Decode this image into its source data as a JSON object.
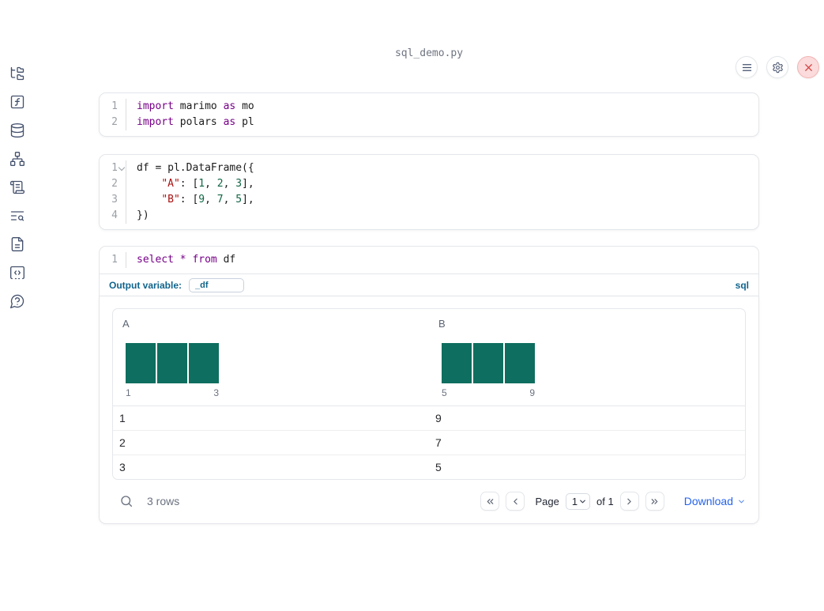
{
  "window": {
    "title": "sql_demo.py"
  },
  "colors": {
    "keyword": "#770088",
    "string": "#aa1111",
    "number": "#116644",
    "histogram_bar": "#0e6e5f",
    "sql_accent": "#10648c",
    "link_blue": "#2563eb",
    "close_red": "#d64545",
    "icon_slate": "#44516d"
  },
  "sidebar": {
    "items": [
      {
        "icon": "file-explorer-icon"
      },
      {
        "icon": "variables-icon"
      },
      {
        "icon": "data-sources-icon"
      },
      {
        "icon": "dependency-graph-icon"
      },
      {
        "icon": "logs-icon"
      },
      {
        "icon": "scratchpad-search-icon"
      },
      {
        "icon": "documentation-icon"
      },
      {
        "icon": "snippets-icon"
      },
      {
        "icon": "help-chat-icon"
      }
    ]
  },
  "toolbar": {
    "buttons": [
      {
        "icon": "menu-icon"
      },
      {
        "icon": "settings-icon"
      },
      {
        "icon": "close-icon"
      }
    ]
  },
  "cells": [
    {
      "name": "imports-cell",
      "lines": [
        {
          "num": "1",
          "tokens": [
            {
              "t": "keyword",
              "s": "import"
            },
            {
              "t": "plain",
              "s": " marimo "
            },
            {
              "t": "keyword",
              "s": "as"
            },
            {
              "t": "plain",
              "s": " mo"
            }
          ]
        },
        {
          "num": "2",
          "tokens": [
            {
              "t": "keyword",
              "s": "import"
            },
            {
              "t": "plain",
              "s": " polars "
            },
            {
              "t": "keyword",
              "s": "as"
            },
            {
              "t": "plain",
              "s": " pl"
            }
          ]
        }
      ]
    },
    {
      "name": "dataframe-cell",
      "lines": [
        {
          "num": "1",
          "fold": true,
          "tokens": [
            {
              "t": "plain",
              "s": "df = pl.DataFrame({"
            }
          ]
        },
        {
          "num": "2",
          "tokens": [
            {
              "t": "plain",
              "s": "    "
            },
            {
              "t": "string",
              "s": "\"A\""
            },
            {
              "t": "plain",
              "s": ": ["
            },
            {
              "t": "number",
              "s": "1"
            },
            {
              "t": "plain",
              "s": ", "
            },
            {
              "t": "number",
              "s": "2"
            },
            {
              "t": "plain",
              "s": ", "
            },
            {
              "t": "number",
              "s": "3"
            },
            {
              "t": "plain",
              "s": "],"
            }
          ]
        },
        {
          "num": "3",
          "tokens": [
            {
              "t": "plain",
              "s": "    "
            },
            {
              "t": "string",
              "s": "\"B\""
            },
            {
              "t": "plain",
              "s": ": ["
            },
            {
              "t": "number",
              "s": "9"
            },
            {
              "t": "plain",
              "s": ", "
            },
            {
              "t": "number",
              "s": "7"
            },
            {
              "t": "plain",
              "s": ", "
            },
            {
              "t": "number",
              "s": "5"
            },
            {
              "t": "plain",
              "s": "],"
            }
          ]
        },
        {
          "num": "4",
          "tokens": [
            {
              "t": "plain",
              "s": "})"
            }
          ]
        }
      ]
    },
    {
      "name": "sql-cell",
      "lines": [
        {
          "num": "1",
          "tokens": [
            {
              "t": "keyword",
              "s": "select"
            },
            {
              "t": "plain",
              "s": " "
            },
            {
              "t": "keyword",
              "s": "*"
            },
            {
              "t": "plain",
              "s": " "
            },
            {
              "t": "keyword",
              "s": "from"
            },
            {
              "t": "plain",
              "s": " df"
            }
          ]
        }
      ],
      "footer": {
        "label": "Output variable:",
        "value": "_df",
        "language": "sql"
      }
    }
  ],
  "output": {
    "chart_data": [
      {
        "type": "bar",
        "title": "A",
        "column": "A",
        "categories": [
          "1",
          "2",
          "3"
        ],
        "values": [
          1,
          1,
          1
        ],
        "xmin_label": "1",
        "xmax_label": "3"
      },
      {
        "type": "bar",
        "title": "B",
        "column": "B",
        "categories": [
          "5",
          "7",
          "9"
        ],
        "values": [
          1,
          1,
          1
        ],
        "xmin_label": "5",
        "xmax_label": "9"
      }
    ],
    "table": {
      "columns": [
        "A",
        "B"
      ],
      "rows": [
        [
          "1",
          "9"
        ],
        [
          "2",
          "7"
        ],
        [
          "3",
          "5"
        ]
      ]
    },
    "footer": {
      "row_count": "3 rows",
      "page_label": "Page",
      "page_value": "1",
      "of_label": "of 1",
      "download_label": "Download"
    }
  }
}
